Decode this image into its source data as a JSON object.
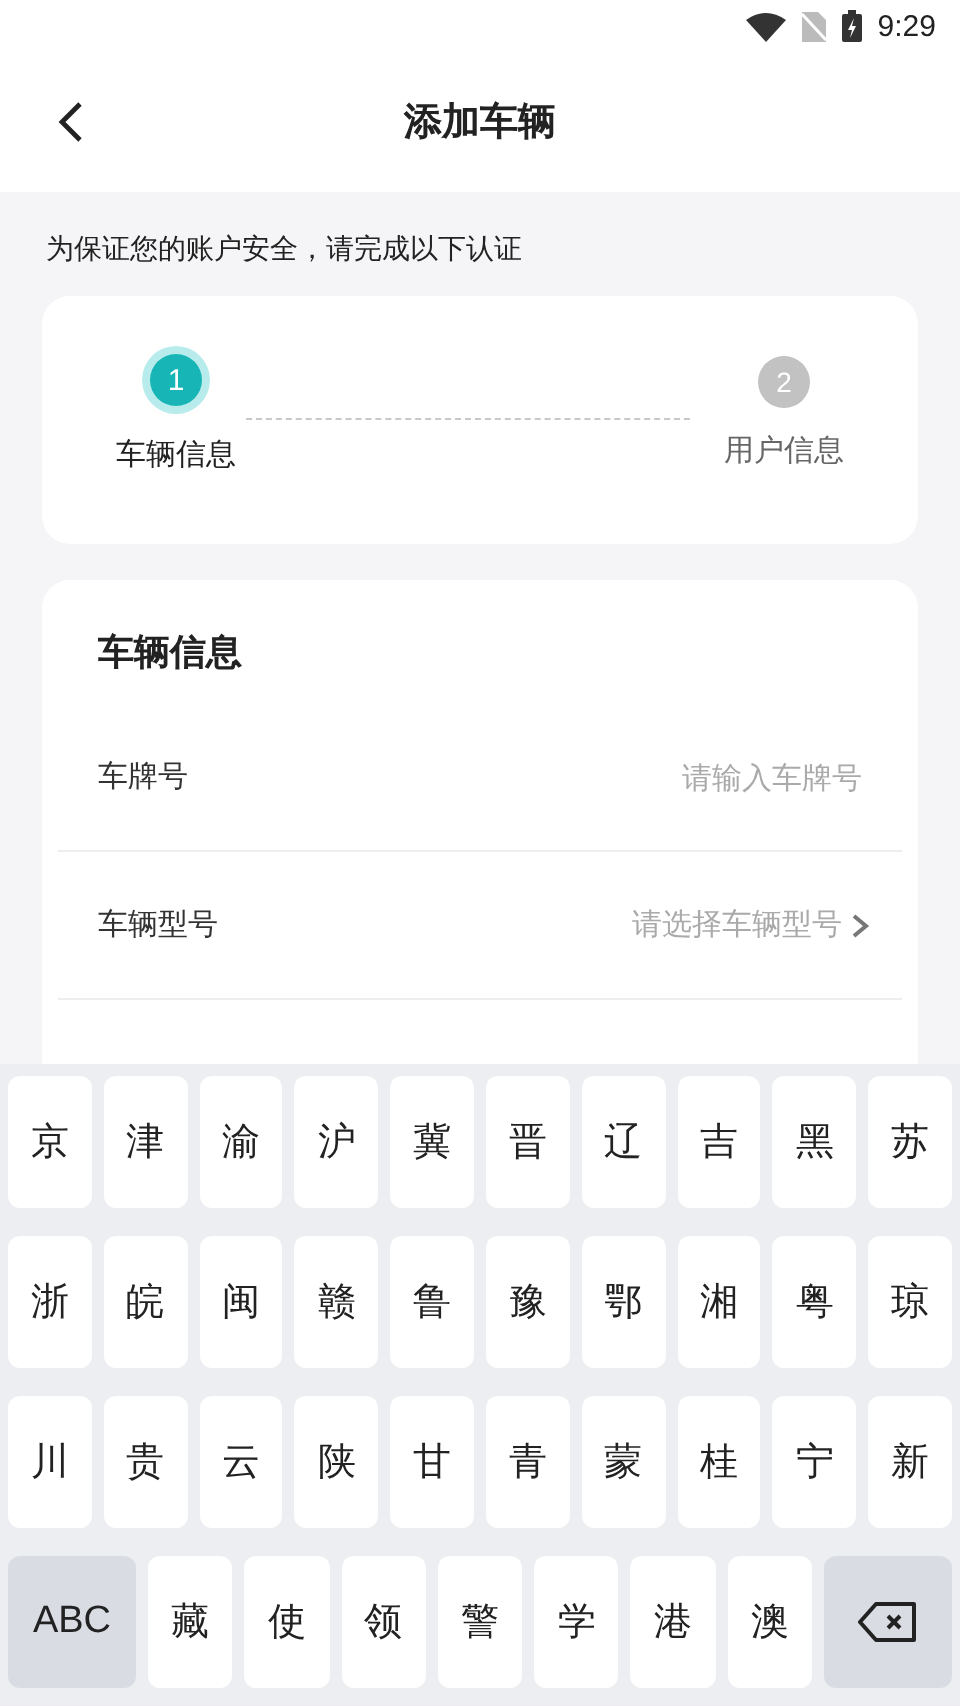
{
  "status_bar": {
    "time": "9:29"
  },
  "header": {
    "title": "添加车辆"
  },
  "notice": "为保证您的账户安全，请完成以下认证",
  "stepper": {
    "steps": [
      {
        "number": "1",
        "label": "车辆信息",
        "selected": true
      },
      {
        "number": "2",
        "label": "用户信息",
        "selected": false
      }
    ]
  },
  "vehicle_form": {
    "title": "车辆信息",
    "fields": [
      {
        "kind": "input",
        "label": "车牌号",
        "placeholder": "请输入车牌号"
      },
      {
        "kind": "select",
        "label": "车辆型号",
        "placeholder": "请选择车辆型号"
      }
    ]
  },
  "keyboard": {
    "rows": [
      [
        "京",
        "津",
        "渝",
        "沪",
        "冀",
        "晋",
        "辽",
        "吉",
        "黑",
        "苏"
      ],
      [
        "浙",
        "皖",
        "闽",
        "赣",
        "鲁",
        "豫",
        "鄂",
        "湘",
        "粤",
        "琼"
      ],
      [
        "川",
        "贵",
        "云",
        "陕",
        "甘",
        "青",
        "蒙",
        "桂",
        "宁",
        "新"
      ]
    ],
    "bottom_row": [
      {
        "kind": "mode",
        "label": "ABC"
      },
      {
        "kind": "char",
        "label": "藏"
      },
      {
        "kind": "char",
        "label": "使"
      },
      {
        "kind": "char",
        "label": "领"
      },
      {
        "kind": "char",
        "label": "警"
      },
      {
        "kind": "char",
        "label": "学"
      },
      {
        "kind": "char",
        "label": "港"
      },
      {
        "kind": "char",
        "label": "澳"
      },
      {
        "kind": "delete"
      }
    ]
  }
}
